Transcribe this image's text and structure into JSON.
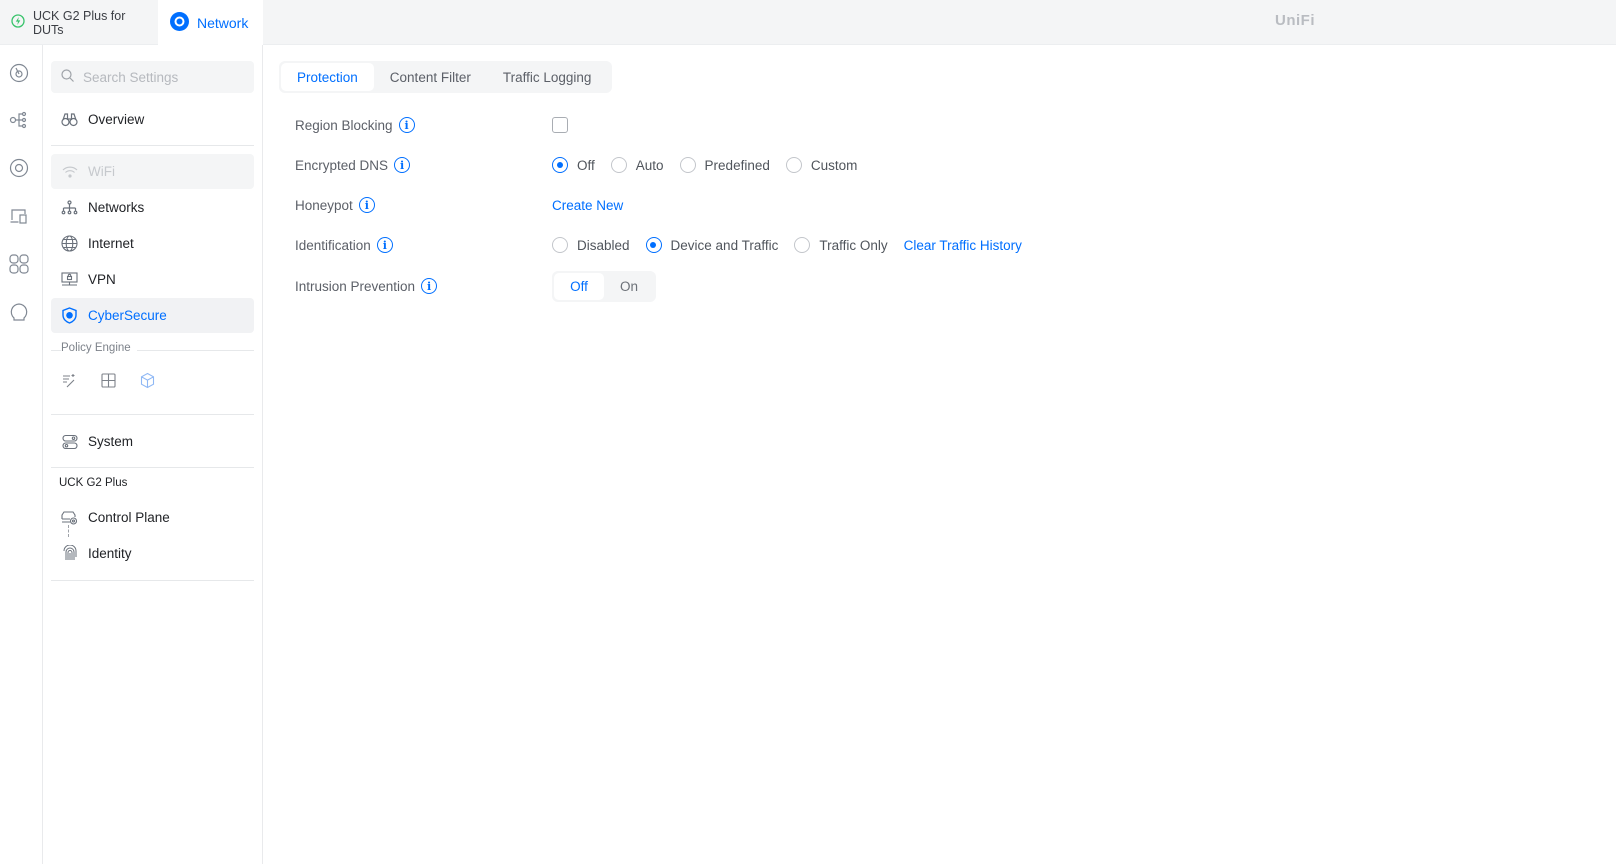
{
  "topbar": {
    "app_tab_1": "UCK G2 Plus for DUTs",
    "app_tab_2": "Network",
    "logo": "UniFi"
  },
  "sidebar": {
    "search_placeholder": "Search Settings",
    "items": [
      {
        "label": "Overview"
      },
      {
        "label": "WiFi"
      },
      {
        "label": "Networks"
      },
      {
        "label": "Internet"
      },
      {
        "label": "VPN"
      },
      {
        "label": "CyberSecure"
      }
    ],
    "policy_engine_label": "Policy Engine",
    "system_label": "System",
    "device_section": "UCK G2 Plus",
    "device_items": [
      {
        "label": "Control Plane"
      },
      {
        "label": "Identity"
      }
    ]
  },
  "main": {
    "tabs": [
      {
        "label": "Protection"
      },
      {
        "label": "Content Filter"
      },
      {
        "label": "Traffic Logging"
      }
    ],
    "region_blocking": {
      "label": "Region Blocking",
      "checked": false
    },
    "encrypted_dns": {
      "label": "Encrypted DNS",
      "options": [
        "Off",
        "Auto",
        "Predefined",
        "Custom"
      ],
      "selected": "Off"
    },
    "honeypot": {
      "label": "Honeypot",
      "action": "Create New"
    },
    "identification": {
      "label": "Identification",
      "options": [
        "Disabled",
        "Device and Traffic",
        "Traffic Only"
      ],
      "selected": "Device and Traffic",
      "action": "Clear Traffic History"
    },
    "intrusion_prevention": {
      "label": "Intrusion Prevention",
      "options": [
        "Off",
        "On"
      ],
      "selected": "Off"
    },
    "info_glyph": "i"
  },
  "colors": {
    "accent": "#006fff",
    "green": "#38c36b"
  }
}
